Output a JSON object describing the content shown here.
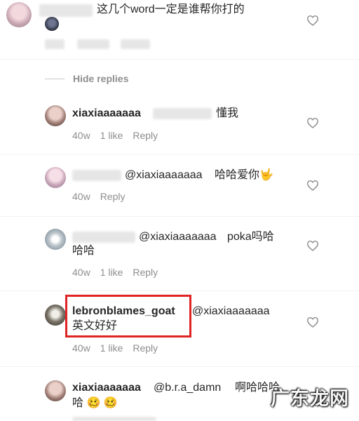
{
  "comments": [
    {
      "id": "c0",
      "text": "这几个word一定是谁帮你打的"
    },
    {
      "id": "c1",
      "username": "xiaxiaaaaaaa",
      "text": "懂我",
      "time": "40w",
      "likes": "1 like",
      "reply": "Reply"
    },
    {
      "id": "c2",
      "mention": "@xiaxiaaaaaaa",
      "text": "哈哈爱你🤟",
      "time": "40w",
      "reply": "Reply"
    },
    {
      "id": "c3",
      "mention": "@xiaxiaaaaaaa",
      "text_line1": "poka吗哈",
      "text_line2": "哈哈",
      "time": "40w",
      "likes": "1 like",
      "reply": "Reply"
    },
    {
      "id": "c4",
      "username": "lebronblames_goat",
      "mention": "@xiaxiaaaaaaa",
      "text_line2": "英文好好",
      "time": "40w",
      "likes": "1 like",
      "reply": "Reply"
    },
    {
      "id": "c5",
      "username": "xiaxiaaaaaaa",
      "mention": "@b.r.a_damn",
      "text_line1": "啊哈哈哈",
      "text_line2": "哈 🥴 🥴"
    }
  ],
  "hide_replies": "Hide replies",
  "watermark": "广东龙网",
  "colors": {
    "highlight_box": "#e02424",
    "meta_text": "#8e8e8e",
    "primary_text": "#262626"
  }
}
